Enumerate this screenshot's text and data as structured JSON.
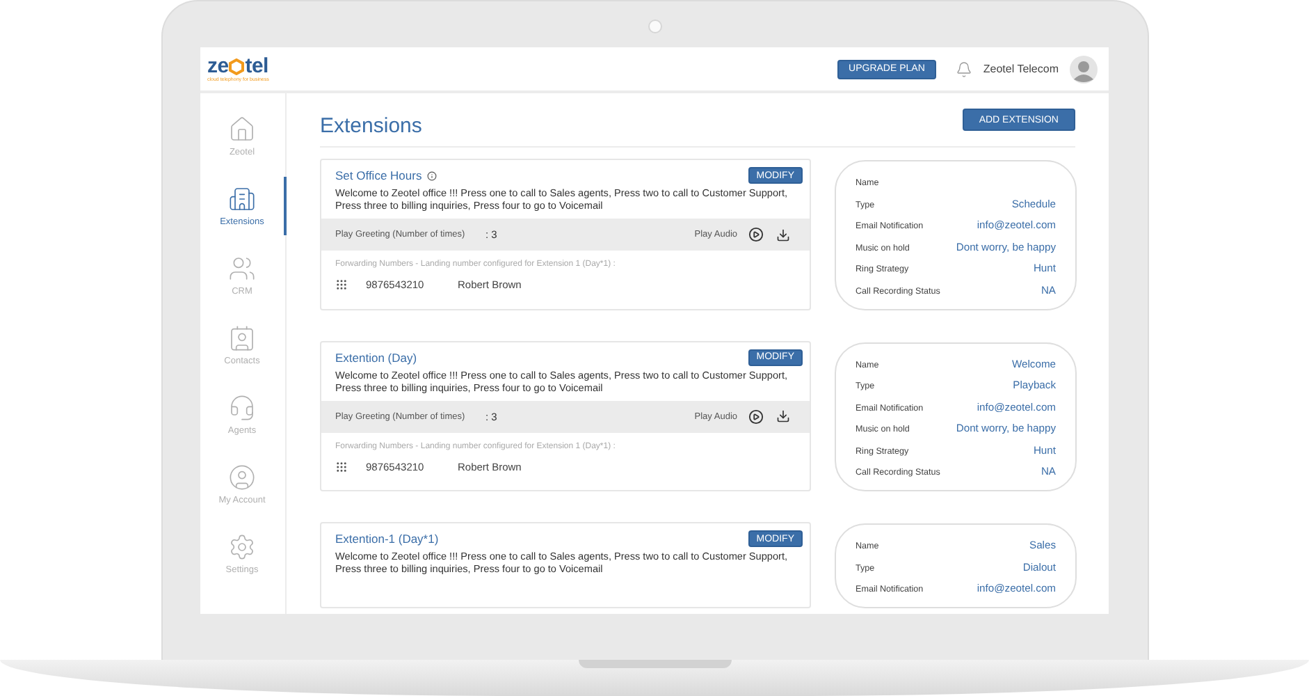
{
  "header": {
    "logo": {
      "before": "ze",
      "after": "tel",
      "tagline": "cloud telephony for business"
    },
    "upgrade_button": "UPGRADE PLAN",
    "user_name": "Zeotel Telecom"
  },
  "sidebar": {
    "items": [
      {
        "label": "Zeotel",
        "kind": "home",
        "selected": false
      },
      {
        "label": "Extensions",
        "kind": "extensions",
        "selected": true
      },
      {
        "label": "CRM",
        "kind": "crm",
        "selected": false
      },
      {
        "label": "Contacts",
        "kind": "contacts",
        "selected": false
      },
      {
        "label": "Agents",
        "kind": "agents",
        "selected": false
      },
      {
        "label": "My Account",
        "kind": "account",
        "selected": false
      },
      {
        "label": "Settings",
        "kind": "settings",
        "selected": false
      }
    ]
  },
  "page": {
    "title": "Extensions",
    "add_button": "ADD EXTENSION"
  },
  "extensions": [
    {
      "title": "Set Office Hours",
      "info_icon": true,
      "modify_button": "MODIFY",
      "message": "Welcome to Zeotel office !!! Press one to call to Sales agents, Press two to call to Customer Support, Press three to billing inquiries, Press four to go to Voicemail",
      "greeting": {
        "label": "Play Greeting (Number of times)",
        "value": ": 3",
        "audio_label": "Play Audio"
      },
      "forwarding": {
        "label": "Forwarding Numbers - Landing number configured for Extension 1 (Day*1) :",
        "number": "9876543210",
        "name": "Robert Brown"
      },
      "details": [
        {
          "label": "Name"
        },
        {
          "label": "Type",
          "value": "Schedule"
        },
        {
          "label": "Email Notification",
          "value": "info@zeotel.com"
        },
        {
          "label": "Music on hold",
          "value": "Dont worry, be happy"
        },
        {
          "label": "Ring Strategy",
          "value": "Hunt"
        },
        {
          "label": "Call Recording Status",
          "value": "NA"
        }
      ]
    },
    {
      "title": "Extention (Day)",
      "info_icon": false,
      "modify_button": "MODIFY",
      "message": "Welcome to Zeotel office !!! Press one to call to Sales agents, Press two to call to Customer Support, Press three to billing inquiries, Press four to go to Voicemail",
      "greeting": {
        "label": "Play Greeting (Number of times)",
        "value": ": 3",
        "audio_label": "Play Audio"
      },
      "forwarding": {
        "label": "Forwarding Numbers - Landing number configured for Extension 1 (Day*1) :",
        "number": "9876543210",
        "name": "Robert Brown"
      },
      "details": [
        {
          "label": "Name",
          "value": "Welcome"
        },
        {
          "label": "Type",
          "value": "Playback"
        },
        {
          "label": "Email Notification",
          "value": "info@zeotel.com"
        },
        {
          "label": "Music on hold",
          "value": "Dont worry, be happy"
        },
        {
          "label": "Ring Strategy",
          "value": "Hunt"
        },
        {
          "label": "Call Recording Status",
          "value": "NA"
        }
      ]
    },
    {
      "title": "Extention-1 (Day*1)",
      "info_icon": false,
      "modify_button": "MODIFY",
      "message": "Welcome to Zeotel office !!! Press one to call to Sales agents, Press two to call to Customer Support, Press three to billing inquiries, Press four to go to Voicemail",
      "details": [
        {
          "label": "Name",
          "value": "Sales"
        },
        {
          "label": "Type",
          "value": "Dialout"
        },
        {
          "label": "Email Notification",
          "value": "info@zeotel.com"
        }
      ]
    }
  ]
}
